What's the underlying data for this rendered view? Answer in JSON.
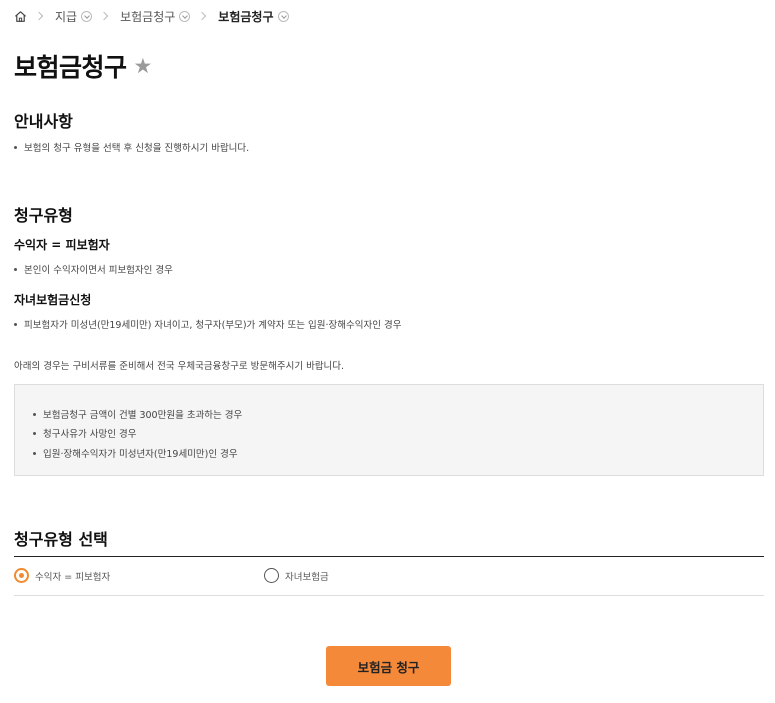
{
  "breadcrumb": {
    "items": [
      "지급",
      "보험금청구",
      "보험금청구"
    ]
  },
  "page": {
    "title": "보험금청구",
    "favorite_icon": "star-icon"
  },
  "guide": {
    "title": "안내사항",
    "text": "보험의 청구 유형을 선택 후 신청을 진행하시기 바랍니다."
  },
  "claim_types": {
    "title": "청구유형",
    "type1": {
      "title": "수익자 = 피보험자",
      "desc": "본인이 수익자이면서 피보험자인 경우"
    },
    "type2": {
      "title": "자녀보험금신청",
      "desc": "피보험자가 미성년(만19세미만) 자녀이고, 청구자(부모)가 계약자 또는 입원·장해수익자인 경우"
    },
    "visit_note": "아래의 경우는 구비서류를 준비해서 전국 우체국금융창구로 방문해주시기 바랍니다.",
    "visit_cases": [
      "보험금청구 금액이 건별 300만원을 초과하는 경우",
      "청구사유가 사망인 경우",
      "입원·장해수익자가 미성년자(만19세미만)인 경우"
    ]
  },
  "select": {
    "title": "청구유형 선택",
    "options": [
      "수익자 = 피보험자",
      "자녀보험금"
    ],
    "selected": "수익자 = 피보험자"
  },
  "submit_label": "보험금 청구",
  "colors": {
    "accent": "#f5893a"
  }
}
